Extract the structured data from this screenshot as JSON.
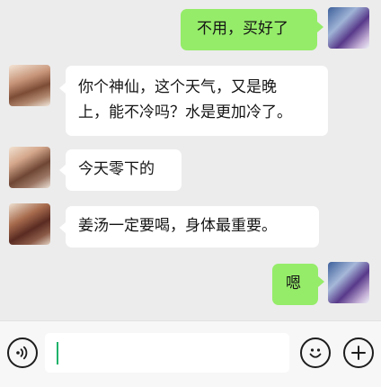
{
  "messages": [
    {
      "side": "out",
      "text": "不用，买好了",
      "avatar": "self-avatar"
    },
    {
      "side": "in",
      "lines": [
        "你个神仙，这个天气，又是晚",
        "上，能不冷吗？水是更加冷了。"
      ],
      "avatar": "contact-avatar"
    },
    {
      "side": "in",
      "text": "今天零下的",
      "avatar": "contact-avatar"
    },
    {
      "side": "in",
      "text": "姜汤一定要喝，身体最重要。",
      "avatar": "contact-avatar"
    },
    {
      "side": "out",
      "text": "嗯",
      "avatar": "self-avatar"
    }
  ],
  "input_bar": {
    "voice_icon": "voice-icon",
    "emoji_icon": "emoji-icon",
    "add_icon": "add-icon",
    "value": ""
  },
  "colors": {
    "background": "#ececec",
    "outgoing_bubble": "#95ec69",
    "incoming_bubble": "#ffffff",
    "caret": "#1fb36a"
  }
}
